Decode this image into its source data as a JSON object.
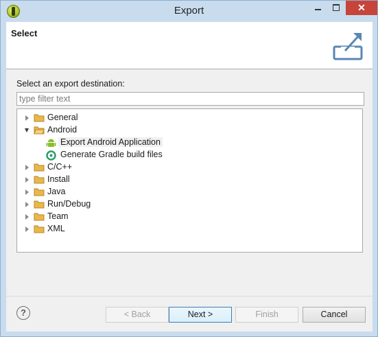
{
  "window": {
    "title": "Export",
    "close_label": "✕"
  },
  "header": {
    "title": "Select"
  },
  "main": {
    "destination_label": "Select an export destination:",
    "filter_placeholder": "type filter text",
    "tree": [
      {
        "label": "General",
        "state": "collapsed"
      },
      {
        "label": "Android",
        "state": "expanded"
      },
      {
        "label": "Export Android Application",
        "child": true,
        "icon": "android-icon"
      },
      {
        "label": "Generate Gradle build files",
        "child": true,
        "icon": "gradle-icon"
      },
      {
        "label": "C/C++",
        "state": "collapsed"
      },
      {
        "label": "Install",
        "state": "collapsed"
      },
      {
        "label": "Java",
        "state": "collapsed"
      },
      {
        "label": "Run/Debug",
        "state": "collapsed"
      },
      {
        "label": "Team",
        "state": "collapsed"
      },
      {
        "label": "XML",
        "state": "collapsed"
      }
    ]
  },
  "footer": {
    "help_glyph": "?",
    "back_label": "< Back",
    "next_label": "Next >",
    "finish_label": "Finish",
    "cancel_label": "Cancel"
  },
  "colors": {
    "titlebar": "#c8dcee",
    "close": "#c7443a",
    "folder": "#e9b84a",
    "android": "#8bbd2e",
    "gradle": "#2c9e6a"
  }
}
